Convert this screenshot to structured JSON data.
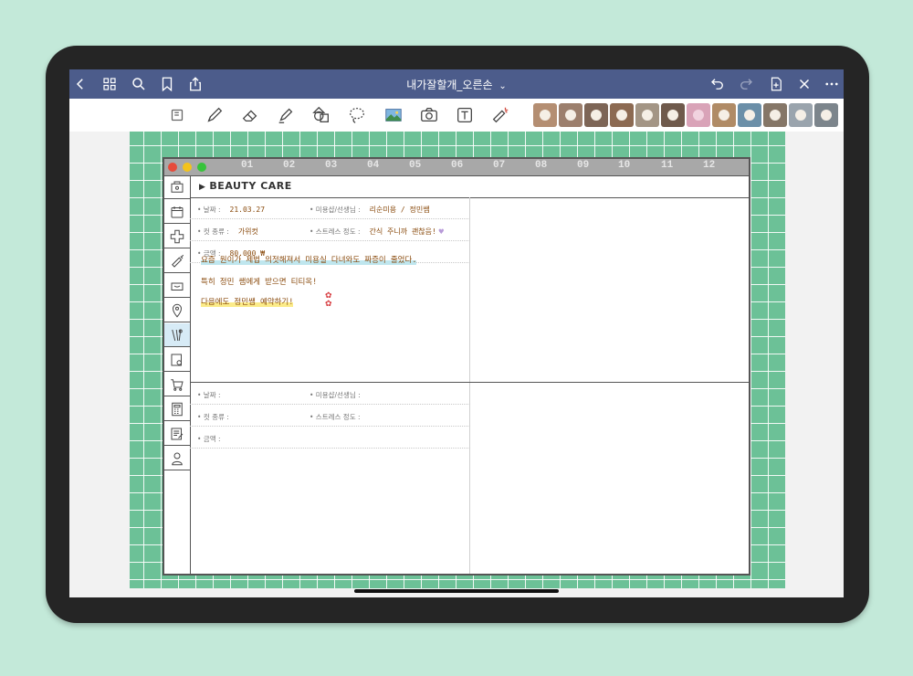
{
  "app": {
    "document_title": "내가잘할개_오른손",
    "title_chevron": "⌄"
  },
  "titlebar": {
    "left_icons": [
      "back-icon",
      "grid-icon",
      "search-icon",
      "bookmark-icon",
      "share-icon"
    ],
    "right_icons": [
      "undo-icon",
      "redo-icon",
      "add-page-icon",
      "close-icon",
      "more-icon"
    ]
  },
  "toolbar": {
    "tools": [
      "reader-icon",
      "pen-icon",
      "eraser-icon",
      "highlighter-icon",
      "shapes-icon",
      "lasso-icon",
      "image-icon",
      "camera-icon",
      "text-icon",
      "laser-pointer-icon"
    ],
    "stickers": 12
  },
  "planner": {
    "window_dots": {
      "red": "#e64b3b",
      "yellow": "#f3c31c",
      "green": "#37c33b"
    },
    "months": [
      "01",
      "02",
      "03",
      "04",
      "05",
      "06",
      "07",
      "08",
      "09",
      "10",
      "11",
      "12"
    ],
    "section_marker": "▶",
    "section_title": "BEAUTY CARE",
    "side_tabs": [
      "home-icon",
      "calendar-icon",
      "medical-cross-icon",
      "syringe-icon",
      "food-bowl-icon",
      "location-pin-icon",
      "grooming-icon",
      "pet-note-icon",
      "shopping-cart-icon",
      "calculator-icon",
      "memo-icon",
      "profile-icon"
    ],
    "labels": {
      "date": "• 날짜 :",
      "salon": "• 미용샵/선생님 :",
      "cut_type": "• 컷 종류 :",
      "stress": "• 스트레스 정도 :",
      "price": "• 금액 :"
    },
    "entry1": {
      "date": "21.03.27",
      "salon": "리순미용 / 정민쌤",
      "cut_type": "가위컷",
      "stress": "간식 주니까 괜찮음!",
      "stress_mark": "♥",
      "price": "80.000 ₩",
      "notes": [
        "요즘 원이가 제법 의젓해져서 미용실 다녀와도 짜증이 줄었다.",
        "특히 정민 쌤에게 받으면 티티옥!",
        "다음에도 정민쌤 예약하기!"
      ],
      "stamp": "✿"
    },
    "entry2": {
      "date": "",
      "salon": "",
      "cut_type": "",
      "stress": "",
      "price": ""
    }
  },
  "colors": {
    "titlebar": "#4c5c8b",
    "grid_background": "#6cc197",
    "handwriting": "#8a4b0e",
    "highlight_blue": "#bfe6ee",
    "highlight_yellow": "#fbeb8a",
    "active_tab": "#d7ebf6"
  }
}
